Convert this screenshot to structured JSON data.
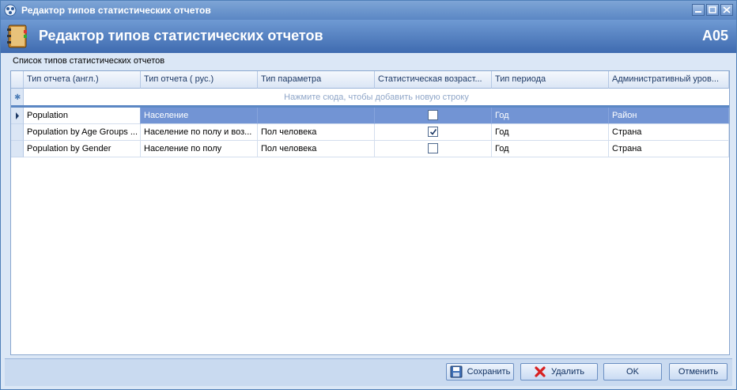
{
  "window": {
    "title": "Редактор типов статистических отчетов"
  },
  "header": {
    "title": "Редактор типов статистических отчетов",
    "code": "A05"
  },
  "section_label": "Список типов статистических отчетов",
  "grid": {
    "columns": [
      "Тип отчета (англ.)",
      "Тип отчета ( рус.)",
      "Тип параметра",
      "Статистическая возраст...",
      "Тип периода",
      "Административный уров..."
    ],
    "new_row_text": "Нажмите сюда, чтобы добавить новую строку",
    "rows": [
      {
        "en": "Population",
        "ru": "Население",
        "param": "",
        "age": false,
        "period": "Год",
        "admin": "Район",
        "selected": true
      },
      {
        "en": "Population by Age Groups ...",
        "ru": "Население по полу и воз...",
        "param": "Пол человека",
        "age": true,
        "period": "Год",
        "admin": "Страна"
      },
      {
        "en": "Population by Gender",
        "ru": "Население по полу",
        "param": "Пол человека",
        "age": false,
        "period": "Год",
        "admin": "Страна"
      }
    ]
  },
  "buttons": {
    "save": "Сохранить",
    "delete": "Удалить",
    "ok": "OK",
    "cancel": "Отменить"
  },
  "colors": {
    "header": "#3f6bb0",
    "selection": "#7294d4",
    "window_bg": "#dbe7f6"
  }
}
